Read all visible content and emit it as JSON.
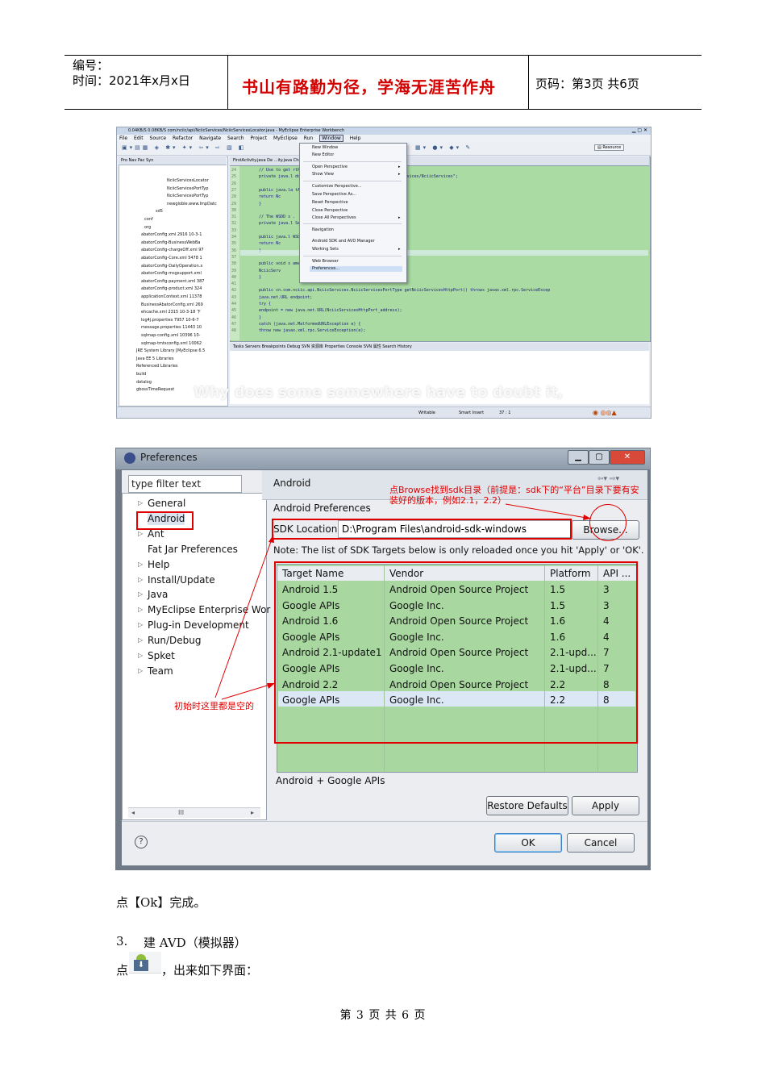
{
  "header": {
    "number_label": "编号：",
    "date_label": "时间：2021年x月x日",
    "motto": "书山有路勤为径，学海无涯苦作舟",
    "page_info": "页码：第3页 共6页"
  },
  "screenshot1": {
    "title": "0.04KB/S  0.08KB/S  com/nciic/api/NciicServices/NciicServicesLocator.java - MyEclipse Enterprise Workbench",
    "menu": [
      "File",
      "Edit",
      "Source",
      "Refactor",
      "Navigate",
      "Search",
      "Project",
      "MyEclipse",
      "Run",
      "Window",
      "Help"
    ],
    "left_tabs": "Pro  Nav  Pac  Syn",
    "tree": [
      "NciicServicesLocator",
      "NciicServicesPortTyp",
      "NciicServicesPortTyp",
      "newgloble.www.ImpDatc",
      "sd5",
      "conf",
      "org",
      "abatorConfig.xml 2916  10-3-1",
      "abatorConfig-BusinessWebBa",
      "abatorConfig-chargeOff.xml 97",
      "abatorConfig-Core.xml 5478  1",
      "abatorConfig-DailyOperation.x",
      "abatorConfig-msgsupport.xml",
      "abatorConfig-payment.xml 387",
      "abatorConfig-product.xml 324",
      "applicationContext.xml 11378",
      "BusinessAbatorConfig.xml 269",
      "ehcache.xml 2315  10-3-18 下",
      "log4j.properties 7957  10-6-7",
      "message.properties 11443  10",
      "sqlmap-config.xml 10396  10-",
      "sqlmap-tmtsconfig.xml 10062",
      "JRE System Library [MyEclipse 6.5",
      "Java EE 5 Libraries",
      "Referenced Libraries",
      "build",
      "datalog",
      "gbossTimeRequest"
    ],
    "editor_tabs": "FirstActivity.java   De   ...ity.java   CheatQueryEduInfoSer   NciicServicesLocator",
    "line_numbers": [
      "24",
      "25",
      "26",
      "27",
      "28",
      "29",
      "30",
      "31",
      "32",
      "33",
      "34",
      "35",
      "36",
      "37",
      "38",
      "39",
      "40",
      "41",
      "42",
      "43",
      "44",
      "45",
      "46",
      "47",
      "48"
    ],
    "code": [
      "// Use to get                                        rtPort",
      "private java.l                                     ddress = \"http://api.nciic.org.cn/nciic_ws/services/NciicServices\";",
      "",
      "public java.la                                     tAddress() {",
      "    return Nc",
      "}",
      "",
      "// The WSDD s                                        .",
      "private java.l                                     ServiceName = \"NciicServicesHttpPort\";",
      "",
      "public java.l                                     WSDDServiceName() {",
      "    return Nc",
      "}",
      "",
      "public void s                                      ame(java.lang.String name) {",
      "    NciicServ",
      "}",
      "",
      "public cn.com.nciic.api.NciicServices.NciicServicesPortType getNciicServicesHttpPort() throws javax.xml.rpc.ServiceExcep",
      "    java.net.URL endpoint;",
      "    try {",
      "        endpoint = new java.net.URL(NciicServicesHttpPort_address);",
      "    }",
      "    catch (java.net.MalformedURLException e) {",
      "        throw new javax.xml.rpc.ServiceException(e);"
    ],
    "window_menu": [
      "New Window",
      "New Editor",
      "Open Perspective",
      "Show View",
      "Customize Perspective...",
      "Save Perspective As...",
      "Reset Perspective",
      "Close Perspective",
      "Close All Perspectives",
      "Navigation",
      "Android SDK and AVD Manager",
      "Working Sets",
      "Web Browser",
      "Preferences..."
    ],
    "views_bar": "Tasks   Servers   Breakpoints   Debug   SVN 资源库   Properties   Console   SVN 属性   Search   History",
    "status": [
      "Writable",
      "Smart Insert",
      "37 : 1"
    ],
    "watermark": "Why does some somewhere have to doubt it,",
    "resource_label": "Resource"
  },
  "preferences": {
    "title": "Preferences",
    "filter_placeholder": "type filter text",
    "tree": [
      "General",
      "Android",
      "Ant",
      "Fat Jar Preferences",
      "Help",
      "Install/Update",
      "Java",
      "MyEclipse Enterprise Wor",
      "Plug-in Development",
      "Run/Debug",
      "Spket",
      "Team"
    ],
    "page_title": "Android",
    "section": "Android Preferences",
    "sdk_label": "SDK Location:",
    "sdk_value": "D:\\Program Files\\android-sdk-windows",
    "browse": "Browse...",
    "note": "Note: The list of SDK Targets below is only reloaded once you hit 'Apply' or 'OK'.",
    "columns": [
      "Target Name",
      "Vendor",
      "Platform",
      "API ..."
    ],
    "rows": [
      [
        "Android 1.5",
        "Android Open Source Project",
        "1.5",
        "3"
      ],
      [
        "Google APIs",
        "Google Inc.",
        "1.5",
        "3"
      ],
      [
        "Android 1.6",
        "Android Open Source Project",
        "1.6",
        "4"
      ],
      [
        "Google APIs",
        "Google Inc.",
        "1.6",
        "4"
      ],
      [
        "Android 2.1-update1",
        "Android Open Source Project",
        "2.1-upd...",
        "7"
      ],
      [
        "Google APIs",
        "Google Inc.",
        "2.1-upd...",
        "7"
      ],
      [
        "Android 2.2",
        "Android Open Source Project",
        "2.2",
        "8"
      ],
      [
        "Google APIs",
        "Google Inc.",
        "2.2",
        "8"
      ]
    ],
    "selected_desc": "Android + Google APIs",
    "restore": "Restore Defaults",
    "apply": "Apply",
    "ok": "OK",
    "cancel": "Cancel",
    "help_icon": "?",
    "annotation_top": "点Browse找到sdk目录（前提是：sdk下的“平台”目录下要有安装好的版本，例如2.1，2.2）",
    "annotation_left": "初始时这里都是空的"
  },
  "doc": {
    "line1": "点【Ok】完成。",
    "line2_num": "3.",
    "line2": "建 AVD（模拟器）",
    "line3_pre": "点",
    "line3_post": "，出来如下界面："
  },
  "footer": "第 3 页 共 6 页"
}
